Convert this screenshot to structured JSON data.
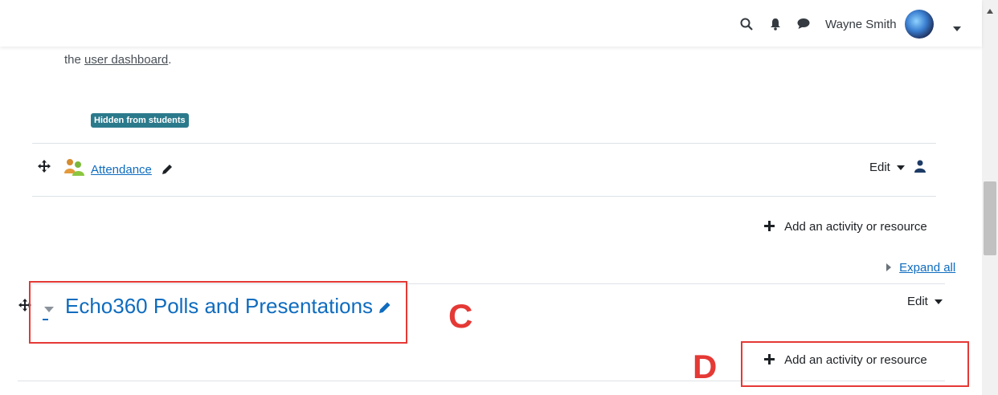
{
  "navbar": {
    "icons": [
      "search-icon",
      "bell-icon",
      "chat-icon"
    ],
    "user_name": "Wayne Smith"
  },
  "section_top": {
    "text_prefix": "the ",
    "dashboard_link": "user dashboard",
    "text_suffix": ".",
    "badge": "Hidden from students"
  },
  "activity": {
    "name": "Attendance",
    "edit_label": "Edit"
  },
  "add_activity_label": "Add an activity or resource",
  "expand_all": "Expand all",
  "section": {
    "title": "Echo360 Polls and Presentations",
    "edit_label": "Edit",
    "add_activity_label": "Add an activity or resource"
  },
  "annotations": {
    "c": "C",
    "d": "D"
  },
  "colors": {
    "link": "#0f6cbf",
    "badge_bg": "#2b7a8c",
    "annotation": "#e53935"
  }
}
